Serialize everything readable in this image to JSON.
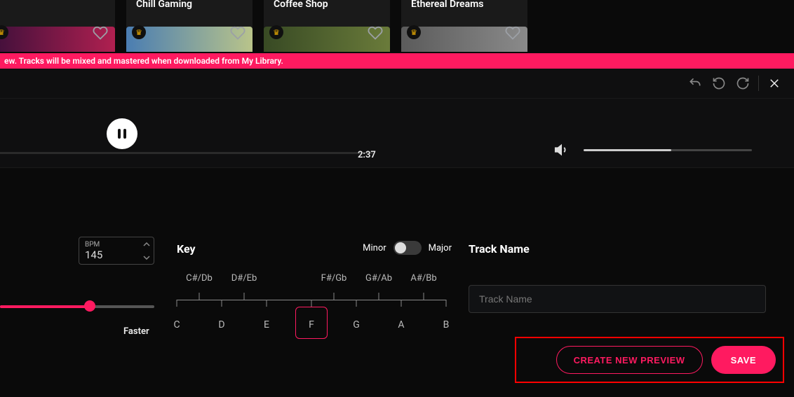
{
  "top_cards": [
    {
      "label": "",
      "cover_gradient": "linear-gradient(90deg,#3c0f3a,#b02050)",
      "has_badge": true
    },
    {
      "label": "Chill Gaming",
      "cover_gradient": "linear-gradient(90deg,#4a7db2,#b9c48a)",
      "has_badge": true
    },
    {
      "label": "Coffee Shop",
      "cover_gradient": "linear-gradient(90deg,#384a24,#6a7b3a)",
      "has_badge": true
    },
    {
      "label": "Ethereal Dreams",
      "cover_gradient": "linear-gradient(90deg,#5b5b5b,#8a8a8a)",
      "has_badge": true
    }
  ],
  "banner_text": "ew. Tracks will be mixed and mastered when downloaded from My Library.",
  "playback_time": "2:37",
  "volume_fill_pct": 52,
  "bpm": {
    "label": "BPM",
    "value": "145",
    "slider_pct": 58,
    "faster_label": "Faster"
  },
  "key": {
    "title": "Key",
    "minor_label": "Minor",
    "major_label": "Major",
    "sharps": [
      "C#/Db",
      "D#/Eb",
      "F#/Gb",
      "G#/Ab",
      "A#/Bb"
    ],
    "naturals": [
      "C",
      "D",
      "E",
      "F",
      "G",
      "A",
      "B"
    ],
    "selected": "F"
  },
  "track_name": {
    "title": "Track Name",
    "placeholder": "Track Name",
    "value": ""
  },
  "buttons": {
    "preview": "CREATE NEW PREVIEW",
    "save": "SAVE"
  }
}
